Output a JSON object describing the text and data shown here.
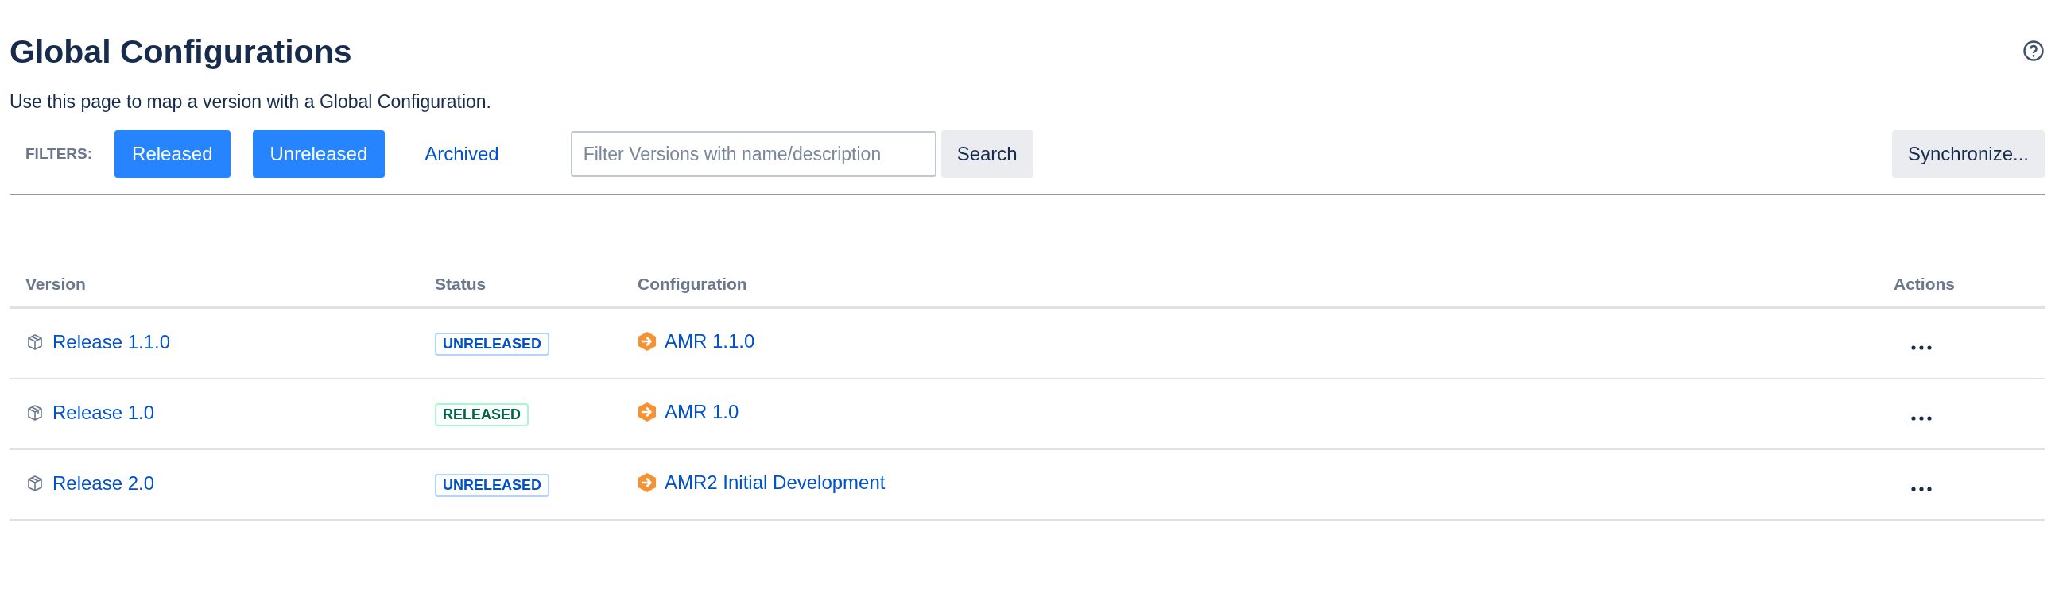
{
  "page": {
    "title": "Global Configurations",
    "description": "Use this page to map a version with a Global Configuration."
  },
  "filters": {
    "label": "FILTERS:",
    "options": [
      {
        "label": "Released",
        "selected": true
      },
      {
        "label": "Unreleased",
        "selected": true
      },
      {
        "label": "Archived",
        "selected": false
      }
    ],
    "search": {
      "placeholder": "Filter Versions with name/description",
      "button": "Search"
    },
    "synchronize": "Synchronize..."
  },
  "table": {
    "columns": [
      "Version",
      "Status",
      "Configuration",
      "Actions"
    ],
    "rows": [
      {
        "version": "Release 1.1.0",
        "status": {
          "label": "UNRELEASED",
          "kind": "unreleased"
        },
        "configuration": "AMR 1.1.0"
      },
      {
        "version": "Release 1.0",
        "status": {
          "label": "RELEASED",
          "kind": "released"
        },
        "configuration": "AMR 1.0"
      },
      {
        "version": "Release 2.0",
        "status": {
          "label": "UNRELEASED",
          "kind": "unreleased"
        },
        "configuration": "AMR2 Initial Development"
      }
    ]
  }
}
